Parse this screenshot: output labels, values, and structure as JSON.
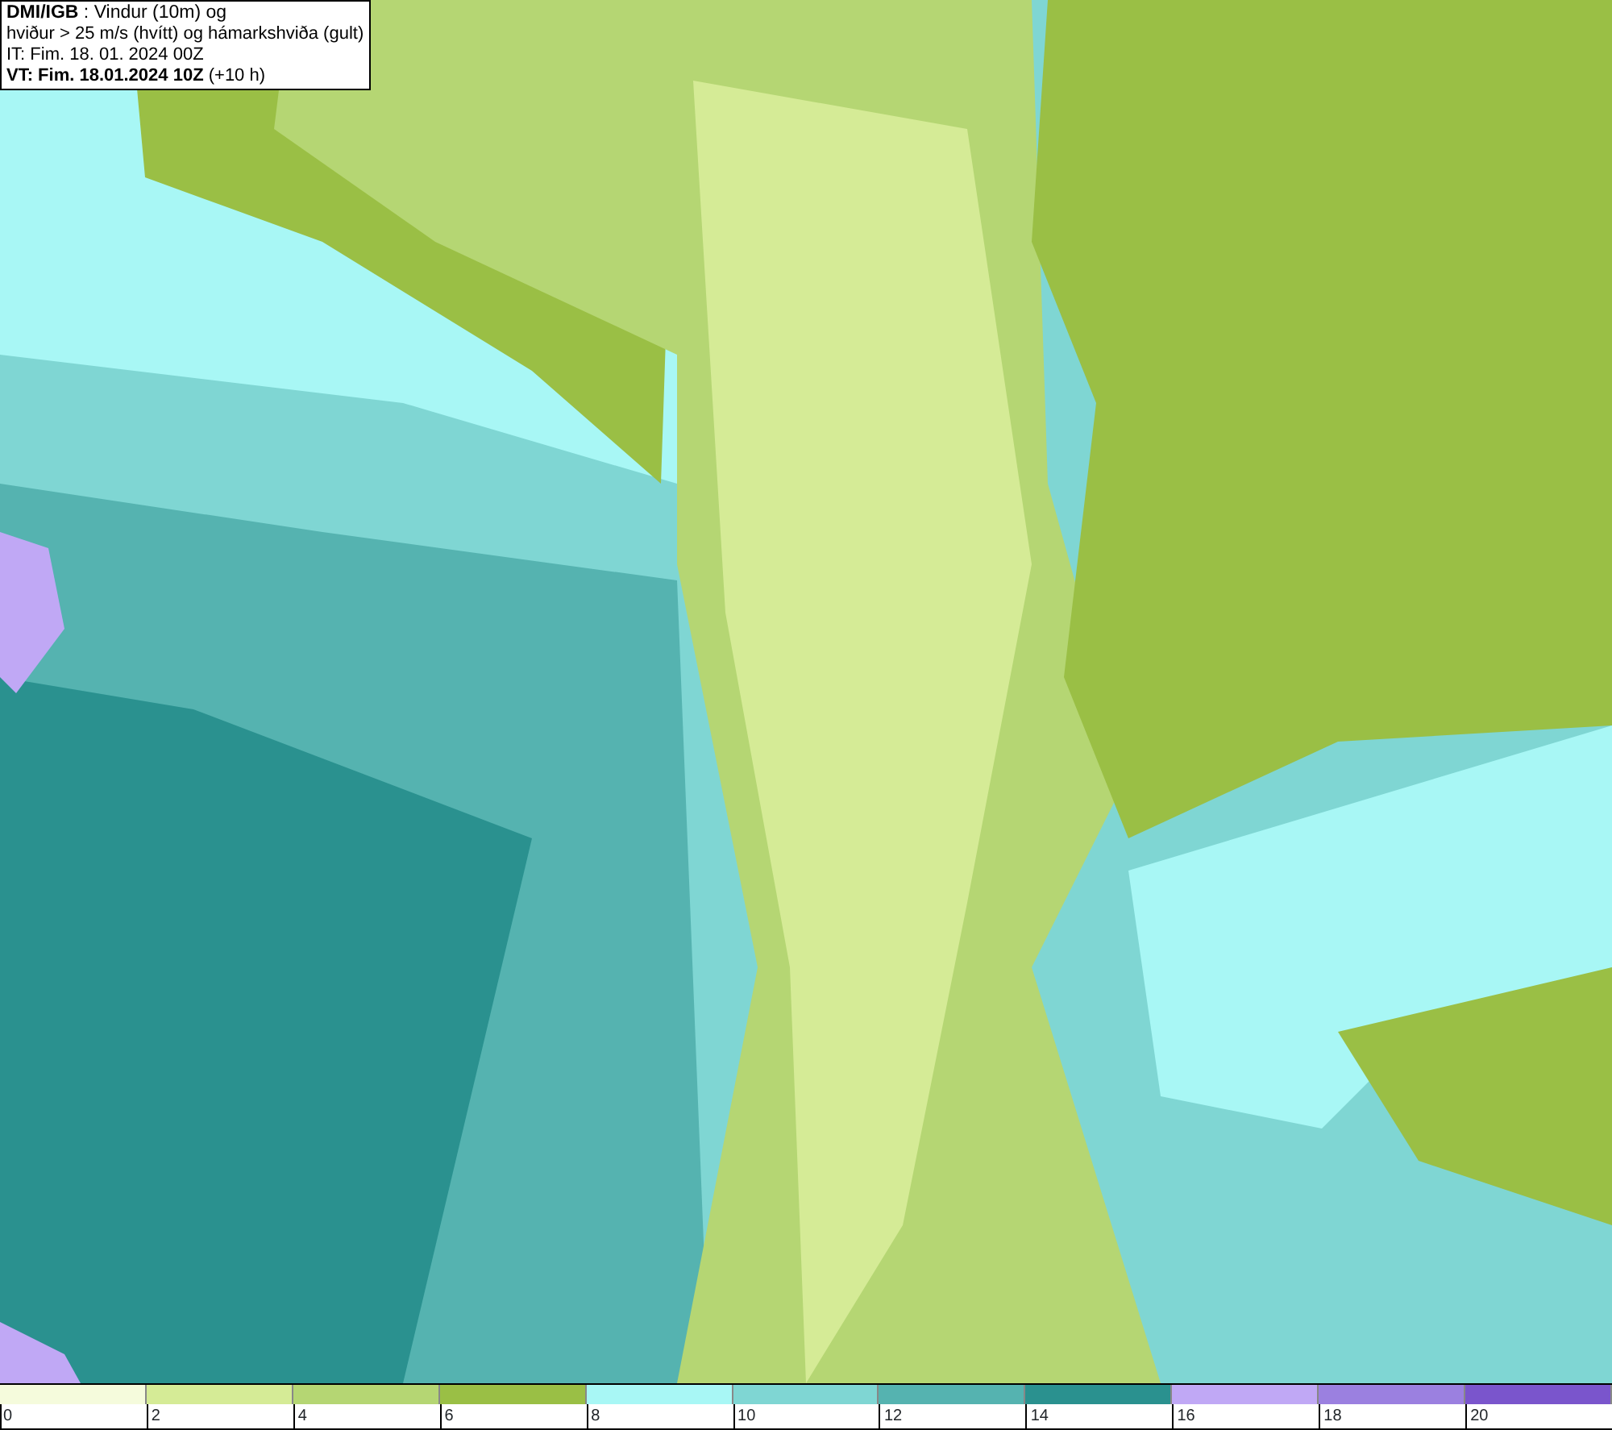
{
  "info_box": {
    "lines": [
      "**DMI/IGB** : Vindur (10m) og",
      "hviður > 25 m/s (hvítt) og hámarkshviða (gult)",
      "IT: Fim. 18. 01. 2024 00Z",
      "**VT: Fim. 18.01.2024 10Z** (+10 h)"
    ]
  },
  "legend": {
    "bins": [
      {
        "color": "#f5fbdc",
        "label": "0"
      },
      {
        "color": "#d5eb96",
        "label": "2"
      },
      {
        "color": "#b5d673",
        "label": "4"
      },
      {
        "color": "#9abf45",
        "label": "6"
      },
      {
        "color": "#a8f7f5",
        "label": "8"
      },
      {
        "color": "#7fd6d3",
        "label": "10"
      },
      {
        "color": "#55b3b0",
        "label": "12"
      },
      {
        "color": "#2a918f",
        "label": "14"
      },
      {
        "color": "#c0a8f5",
        "label": "16"
      },
      {
        "color": "#9b80e0",
        "label": "18"
      },
      {
        "color": "#7a55cc",
        "label": "20"
      }
    ]
  }
}
